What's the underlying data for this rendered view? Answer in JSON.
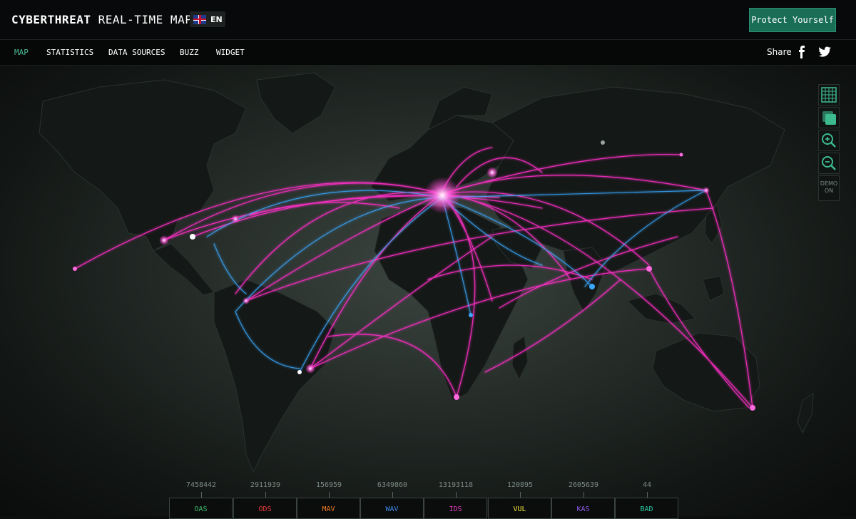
{
  "header": {
    "title_bold": "CYBERTHREAT",
    "title_rest": " REAL-TIME MAP",
    "lang_code": "EN",
    "lang_icon": "uk-flag-icon",
    "protect_label": "Protect Yourself"
  },
  "nav": {
    "items": [
      {
        "label": "MAP",
        "active": true
      },
      {
        "label": "STATISTICS",
        "active": false
      },
      {
        "label": "DATA SOURCES",
        "active": false
      },
      {
        "label": "BUZZ",
        "active": false
      },
      {
        "label": "WIDGET",
        "active": false
      }
    ],
    "share_label": "Share",
    "share_icons": [
      "facebook-icon",
      "twitter-icon"
    ]
  },
  "map_controls": {
    "icons": [
      "grid-icon",
      "layers-icon",
      "zoom-in-icon",
      "zoom-out-icon"
    ],
    "demo_label_1": "DEMO",
    "demo_label_2": "ON"
  },
  "colors": {
    "accent": "#1a6e56",
    "active_nav": "#4fb896",
    "attack_pink": "#ff2fc8",
    "attack_blue": "#3aa8ff"
  },
  "stats": [
    {
      "count": "7458442",
      "label": "OAS",
      "color": "#3dbb6e"
    },
    {
      "count": "2911939",
      "label": "ODS",
      "color": "#e53a3a"
    },
    {
      "count": "156959",
      "label": "MAV",
      "color": "#f07a22"
    },
    {
      "count": "6349860",
      "label": "WAV",
      "color": "#3a86e5"
    },
    {
      "count": "13193118",
      "label": "IDS",
      "color": "#e23ab8"
    },
    {
      "count": "120895",
      "label": "VUL",
      "color": "#f2e23a"
    },
    {
      "count": "2605639",
      "label": "KAS",
      "color": "#8b5ae5"
    },
    {
      "count": "44",
      "label": "BAD",
      "color": "#28c7a3"
    }
  ]
}
